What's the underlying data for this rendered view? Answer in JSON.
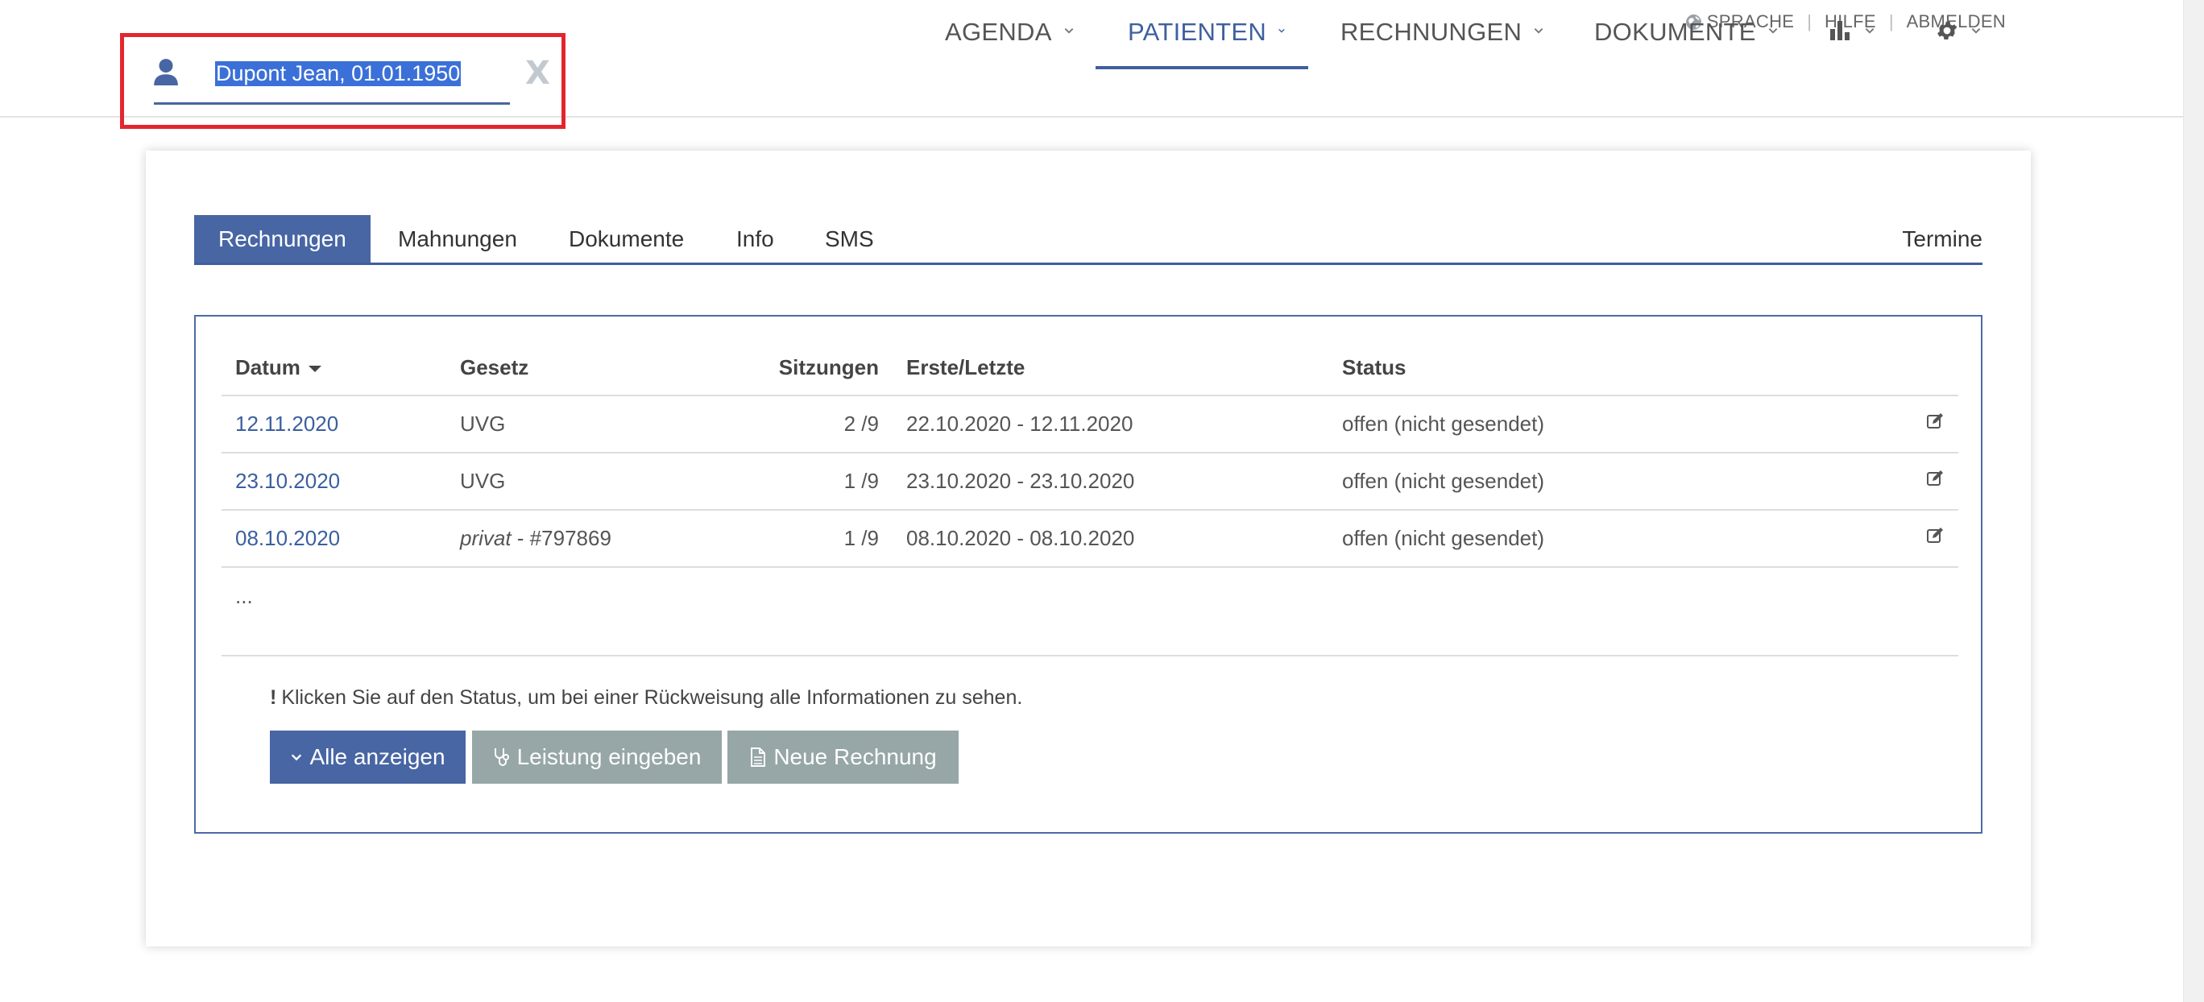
{
  "utility_nav": {
    "language": "SPRACHE",
    "help": "HILFE",
    "logout": "ABMELDEN"
  },
  "patient_search": {
    "value": "Dupont Jean, 01.01.1950",
    "clear": "X"
  },
  "main_nav": [
    {
      "label": "AGENDA"
    },
    {
      "label": "PATIENTEN",
      "active": true
    },
    {
      "label": "RECHNUNGEN"
    },
    {
      "label": "DOKUMENTE"
    },
    {
      "icon": "bar-chart-icon"
    },
    {
      "icon": "gear-icon"
    }
  ],
  "tabs": {
    "rechnungen": "Rechnungen",
    "mahnungen": "Mahnungen",
    "dokumente": "Dokumente",
    "info": "Info",
    "sms": "SMS",
    "termine": "Termine"
  },
  "table": {
    "headers": {
      "datum": "Datum",
      "gesetz": "Gesetz",
      "sitzungen": "Sitzungen",
      "erste_letzte": "Erste/Letzte",
      "status": "Status"
    },
    "rows": [
      {
        "datum": "12.11.2020",
        "gesetz": "UVG",
        "gesetz_suffix": "",
        "sitzungen": "2 /9",
        "erste_letzte": "22.10.2020 - 12.11.2020",
        "status": "offen (nicht gesendet)"
      },
      {
        "datum": "23.10.2020",
        "gesetz": "UVG",
        "gesetz_suffix": "",
        "sitzungen": "1 /9",
        "erste_letzte": "23.10.2020 - 23.10.2020",
        "status": "offen (nicht gesendet)"
      },
      {
        "datum": "08.10.2020",
        "gesetz": "privat",
        "gesetz_suffix": " - #797869",
        "sitzungen": "1 /9",
        "erste_letzte": "08.10.2020 - 08.10.2020",
        "status": "offen (nicht gesendet)"
      }
    ],
    "more": "..."
  },
  "note": {
    "icon": "!",
    "text": "Klicken Sie auf den Status, um bei einer Rückweisung alle Informationen zu sehen."
  },
  "buttons": {
    "show_all": "Alle anzeigen",
    "enter_service": "Leistung eingeben",
    "new_invoice": "Neue Rechnung"
  },
  "colors": {
    "accent": "#4866a4",
    "link": "#3a5fa0",
    "highlight_box": "#e3262e",
    "secondary_button": "#97a6a6"
  }
}
